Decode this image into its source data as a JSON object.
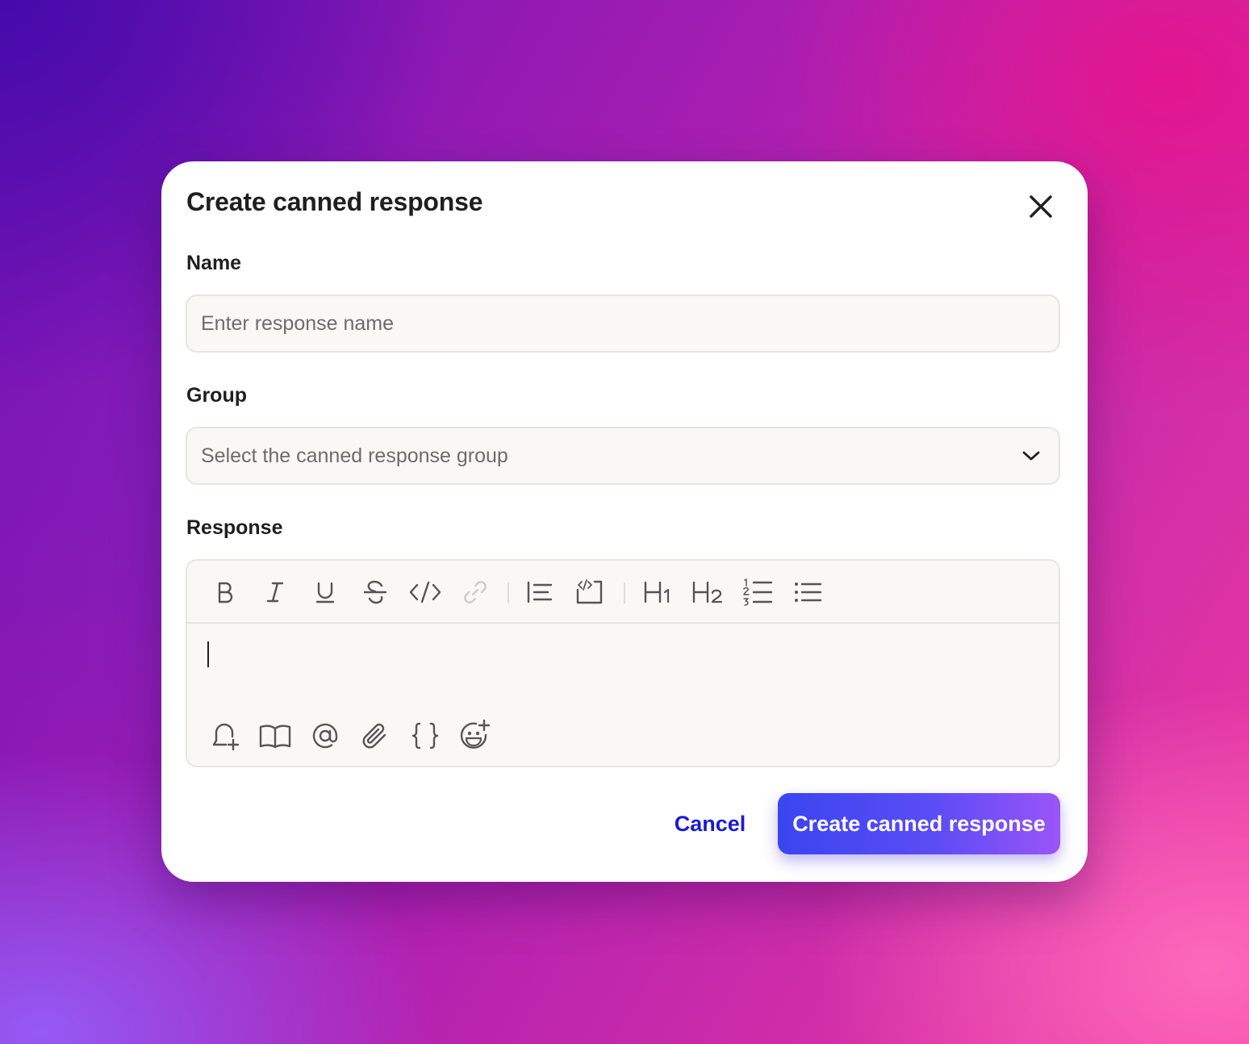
{
  "modal": {
    "title": "Create canned response",
    "close_icon": "close-icon"
  },
  "name_field": {
    "label": "Name",
    "placeholder": "Enter response name",
    "value": ""
  },
  "group_field": {
    "label": "Group",
    "placeholder": "Select the canned response group",
    "icon": "chevron-down-icon"
  },
  "response_field": {
    "label": "Response",
    "value": "",
    "toolbar": [
      "bold-icon",
      "italic-icon",
      "underline-icon",
      "strikethrough-icon",
      "code-icon",
      "link-icon",
      "blockquote-icon",
      "code-block-icon",
      "heading-1-icon",
      "heading-2-icon",
      "ordered-list-icon",
      "bullet-list-icon"
    ],
    "bottom_toolbar": [
      "add-note-icon",
      "knowledge-base-icon",
      "mention-icon",
      "attachment-icon",
      "variables-icon",
      "emoji-icon"
    ]
  },
  "actions": {
    "cancel_label": "Cancel",
    "submit_label": "Create canned response"
  },
  "colors": {
    "primary_start": "#3a45f0",
    "primary_end": "#9a55f8",
    "link": "#1a1ad8",
    "field_bg": "#f9f8f4"
  }
}
